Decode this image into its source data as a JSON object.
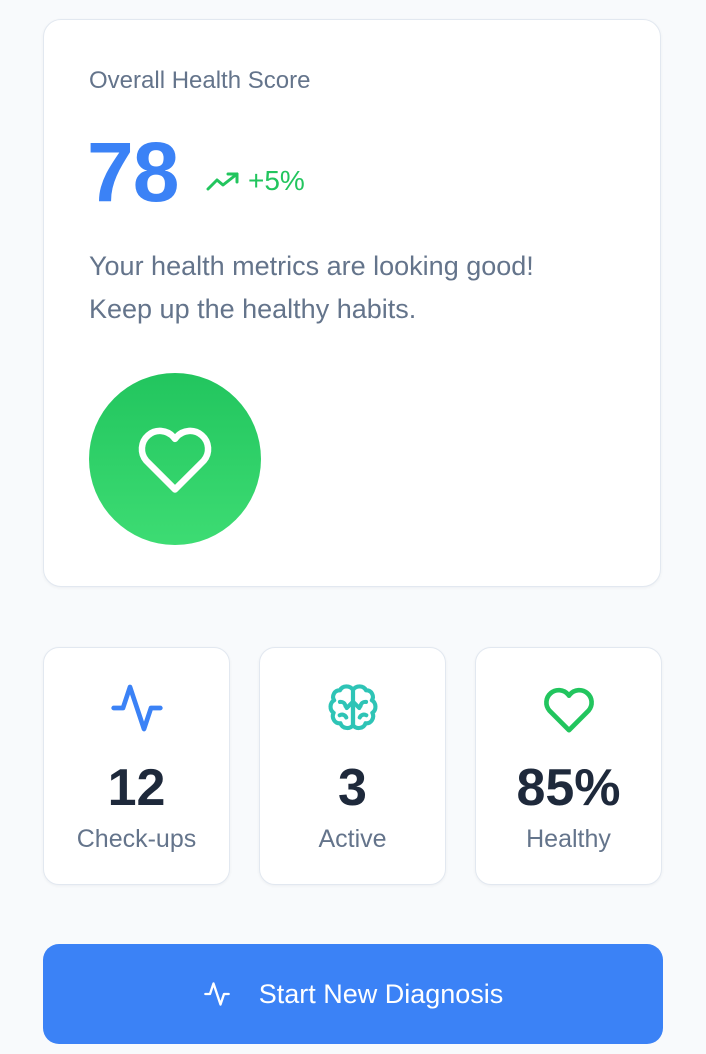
{
  "score_card": {
    "title": "Overall Health Score",
    "score": "78",
    "trend": "+5%",
    "trend_icon": "trending-up-icon",
    "message_line1": "Your health metrics are looking good!",
    "message_line2": "Keep up the healthy habits.",
    "badge_icon": "heart-icon"
  },
  "stats": [
    {
      "icon": "activity-icon",
      "value": "12",
      "label": "Check-ups",
      "color": "#3b82f6"
    },
    {
      "icon": "brain-icon",
      "value": "3",
      "label": "Active",
      "color": "#2ec4b6"
    },
    {
      "icon": "heart-icon",
      "value": "85%",
      "label": "Healthy",
      "color": "#22c55e"
    }
  ],
  "cta": {
    "label": "Start New Diagnosis",
    "icon": "activity-icon"
  },
  "colors": {
    "primary": "#3b82f6",
    "success": "#22c55e",
    "teal": "#2ec4b6",
    "text_dark": "#1e293b",
    "text_muted": "#64748b",
    "background": "#f8fafc"
  }
}
